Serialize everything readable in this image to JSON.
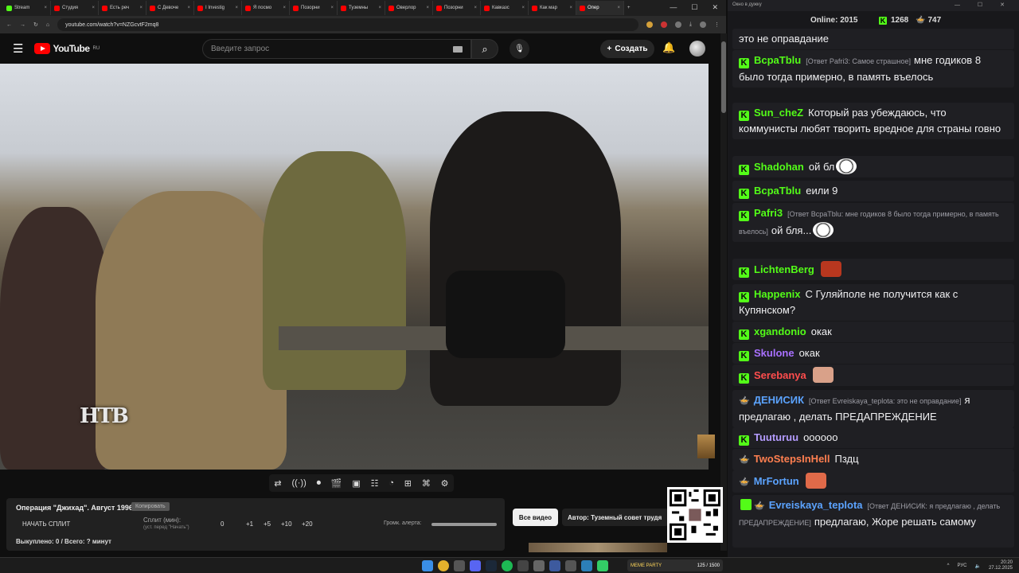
{
  "browser": {
    "tabs": [
      {
        "title": "Stream",
        "icon": "kick-icon",
        "active": false
      },
      {
        "title": "Студия",
        "icon": "youtube-icon",
        "active": false
      },
      {
        "title": "Есть реч",
        "icon": "youtube-icon",
        "active": false
      },
      {
        "title": "С Девоче",
        "icon": "youtube-icon",
        "active": false
      },
      {
        "title": "I Investig",
        "icon": "youtube-icon",
        "active": false
      },
      {
        "title": "Я посмо",
        "icon": "youtube-icon",
        "active": false
      },
      {
        "title": "Позорни",
        "icon": "youtube-icon",
        "active": false
      },
      {
        "title": "Туземны",
        "icon": "youtube-icon",
        "active": false
      },
      {
        "title": "Оверлор",
        "icon": "youtube-icon",
        "active": false
      },
      {
        "title": "Позорни",
        "icon": "youtube-icon",
        "active": false
      },
      {
        "title": "Кавказс",
        "icon": "youtube-icon",
        "active": false
      },
      {
        "title": "Как мар",
        "icon": "youtube-icon",
        "active": false
      },
      {
        "title": "Опер",
        "icon": "youtube-icon",
        "active": true
      }
    ],
    "url": "youtube.com/watch?v=NZGcvtF2mq8"
  },
  "youtube": {
    "logo_text": "YouTube",
    "region": "RU",
    "search_placeholder": "Введите запрос",
    "create_label": "Создать",
    "watermark": "НТВ"
  },
  "tools_panel": {
    "video_title": "Операция \"Джихад\". Август 1996.",
    "copy_label": "Копировать",
    "start_split": "НАЧАТЬ СПЛИТ",
    "split_label": "Сплит (мин):",
    "split_hint": "(уст. перед \"Начать\")",
    "split_value": "0",
    "increments": [
      "+1",
      "+5",
      "+10",
      "+20"
    ],
    "volume_label": "Громк. алерта:",
    "status": "Выкуплено: 0 / Всего: ? минут",
    "all_videos": "Все видео",
    "author": "Автор: Туземный совет трудя"
  },
  "chat": {
    "window_title": "Окно в дужку",
    "online_label": "Online:",
    "online_count": "2015",
    "kick_count": "1268",
    "pot_count": "747",
    "messages": [
      {
        "user": "",
        "color": "#efeff1",
        "reply": "",
        "text": "это не оправдание"
      },
      {
        "user": "BcpaTblu",
        "color": "#53fc18",
        "reply": "[Ответ Pafri3: Самое страшное]",
        "text": "мне годиков 8 было тогда примерно, в память въелось"
      },
      {
        "user": "Sun_cheZ",
        "color": "#53fc18",
        "reply": "",
        "text": "Который раз убеждаюсь, что коммунисты любят творить вредное для страны говно"
      },
      {
        "user": "Shadohan",
        "color": "#53fc18",
        "reply": "",
        "text": "ой бл"
      },
      {
        "user": "BcpaTblu",
        "color": "#53fc18",
        "reply": "",
        "text": "еили 9"
      },
      {
        "user": "Pafri3",
        "color": "#53fc18",
        "reply": "[Ответ BcpaTblu: мне годиков 8 было тогда примерно, в память въелось]",
        "text": "ой бля..."
      },
      {
        "user": "LichtenBerg",
        "color": "#53fc18",
        "reply": "",
        "text": ""
      },
      {
        "user": "Happenix",
        "color": "#53fc18",
        "reply": "",
        "text": "С Гуляйполе не получится как с Купянском?"
      },
      {
        "user": "xgandonio",
        "color": "#53fc18",
        "reply": "",
        "text": "окак"
      },
      {
        "user": "Skulone",
        "color": "#a970ff",
        "reply": "",
        "text": "окак"
      },
      {
        "user": "Serebanya",
        "color": "#ff4d4d",
        "reply": "",
        "text": ""
      },
      {
        "user": "ДЕНИСИК",
        "color": "#5ba3ff",
        "reply": "[Ответ Evreiskaya_teplota: это не оправдание]",
        "text": "я предлагаю , делать ПРЕДАПРЕЖДЕНИЕ"
      },
      {
        "user": "Tuuturuu",
        "color": "#b59cff",
        "reply": "",
        "text": "оооооо"
      },
      {
        "user": "TwoStepsInHell",
        "color": "#ff7f50",
        "reply": "",
        "text": "Пздц"
      },
      {
        "user": "MrFortun",
        "color": "#5ba3ff",
        "reply": "",
        "text": ""
      },
      {
        "user": "Evreiskaya_teplota",
        "color": "#5ba3ff",
        "reply": "[Ответ ДЕНИСИК: я предлагаю , делать ПРЕДАПРЕЖДЕНИЕ]",
        "text": "предлагаю, Жоре решать самому"
      }
    ]
  },
  "taskbar": {
    "meme_label": "MEME PARTY",
    "meme_count": "125 / 1500",
    "lang": "РУС",
    "time": "20:20",
    "date": "27.12.2025"
  }
}
